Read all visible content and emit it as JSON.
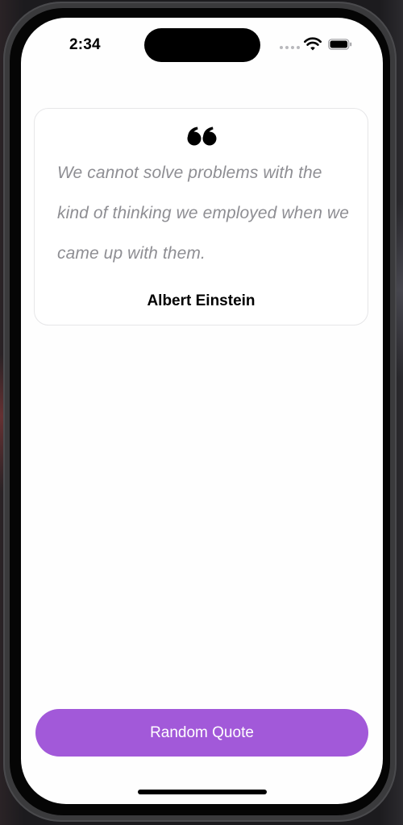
{
  "status_bar": {
    "time": "2:34"
  },
  "quote": {
    "text": "We cannot solve problems with the kind of thinking we employed when we came up with them.",
    "author": "Albert Einstein",
    "icon": "quote-mark-icon"
  },
  "actions": {
    "random_quote_label": "Random Quote"
  },
  "colors": {
    "accent": "#a259d9",
    "quote_text": "#8e8e93",
    "card_border": "#e6e6e8"
  }
}
